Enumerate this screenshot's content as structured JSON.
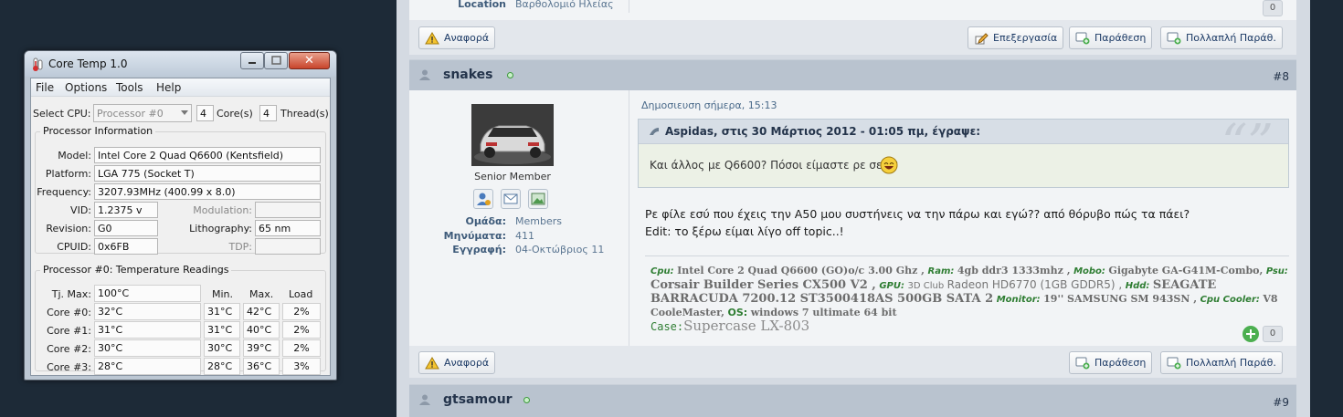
{
  "forum": {
    "prev_post": {
      "location_label": "Location",
      "location_value": "Βαρθολομιό Ηλείας",
      "likes": "0",
      "report_label": "Αναφορά",
      "edit_label": "Επεξεργασία",
      "quote_label": "Παράθεση",
      "multiquote_label": "Πολλαπλή Παράθ."
    },
    "post": {
      "username": "snakes",
      "number": "#8",
      "date": "Δημοσιευση σήμερα, 15:13",
      "rank": "Senior Member",
      "group_label": "Ομάδα:",
      "group_value": "Members",
      "messages_label": "Μηνύματα:",
      "messages_value": "411",
      "joined_label": "Εγγραφή:",
      "joined_value": "04-Οκτώβριος 11",
      "quote_header": "Aspidas, στις 30 Μάρτιος 2012 - 01:05 πμ, έγραψε:",
      "quote_text": "Και άλλος με Q6600? Πόσοι είμαστε ρε σεις?",
      "body_line1": "Ρε φίλε εσύ που έχεις την A50 μου συστήνεις να την πάρω και εγώ?? από θόρυβο πώς τα πάει?",
      "body_line2": "Edit: το ξέρω είμαι λίγο off topic..!",
      "signature": {
        "cpu_label": "Cpu:",
        "cpu_value": "Intel Core 2 Quad Q6600 (GO)o/c 3.00 Ghz ,",
        "ram_label": "Ram:",
        "ram_value": "4gb ddr3 1333mhz ,",
        "mobo_label": "Mobo:",
        "mobo_value": "Gigabyte GA-G41M-Combo,",
        "psu_label": "Psu:",
        "psu_value": "Corsair Builder Series CX500 V2 ,",
        "gpu_label": "GPU:",
        "gpu_value_a": "3D Club",
        "gpu_value_b": "Radeon HD6770 (1GB GDDR5) ,",
        "hdd_label": "Hdd:",
        "hdd_value": "SEAGATE BARRACUDA 7200.12 ST3500418AS 500GB SATA 2",
        "monitor_label": "Monitor:",
        "monitor_value": "19'' SAMSUNG SM 943SN ,",
        "cooler_label": "Cpu Cooler:",
        "cooler_value": "V8 CooleMaster,",
        "os_label": "OS:",
        "os_value": "windows 7 ultimate 64 bit",
        "case_label": "Case:",
        "case_value": "Supercase LX-803"
      },
      "likes": "0",
      "report_label": "Αναφορά",
      "quote_label": "Παράθεση",
      "multiquote_label": "Πολλαπλή Παράθ."
    },
    "next_post": {
      "username": "gtsamour",
      "number": "#9"
    }
  },
  "coretemp": {
    "title": "Core Temp 1.0",
    "close_glyph": "✕",
    "menu": [
      "File",
      "Options",
      "Tools",
      "Help"
    ],
    "select_cpu_label": "Select CPU:",
    "select_cpu_value": "Processor #0",
    "cores_count": "4",
    "cores_label": "Core(s)",
    "threads_count": "4",
    "threads_label": "Thread(s)",
    "proc_info_title": "Processor Information",
    "model_label": "Model:",
    "model_value": "Intel Core 2 Quad Q6600 (Kentsfield)",
    "platform_label": "Platform:",
    "platform_value": "LGA 775 (Socket T)",
    "frequency_label": "Frequency:",
    "frequency_value": "3207.93MHz (400.99 x 8.0)",
    "vid_label": "VID:",
    "vid_value": "1.2375 v",
    "modulation_label": "Modulation:",
    "modulation_value": "",
    "revision_label": "Revision:",
    "revision_value": "G0",
    "lithography_label": "Lithography:",
    "lithography_value": "65 nm",
    "cpuid_label": "CPUID:",
    "cpuid_value": "0x6FB",
    "tdp_label": "TDP:",
    "tdp_value": "",
    "temps_title": "Processor #0: Temperature Readings",
    "tjmax_label": "Tj. Max:",
    "tjmax_value": "100°C",
    "col_min": "Min.",
    "col_max": "Max.",
    "col_load": "Load",
    "cores": [
      {
        "label": "Core #0:",
        "temp": "32°C",
        "min": "31°C",
        "max": "42°C",
        "load": "2%"
      },
      {
        "label": "Core #1:",
        "temp": "31°C",
        "min": "31°C",
        "max": "40°C",
        "load": "2%"
      },
      {
        "label": "Core #2:",
        "temp": "30°C",
        "min": "30°C",
        "max": "39°C",
        "load": "2%"
      },
      {
        "label": "Core #3:",
        "temp": "28°C",
        "min": "28°C",
        "max": "36°C",
        "load": "3%"
      }
    ]
  }
}
